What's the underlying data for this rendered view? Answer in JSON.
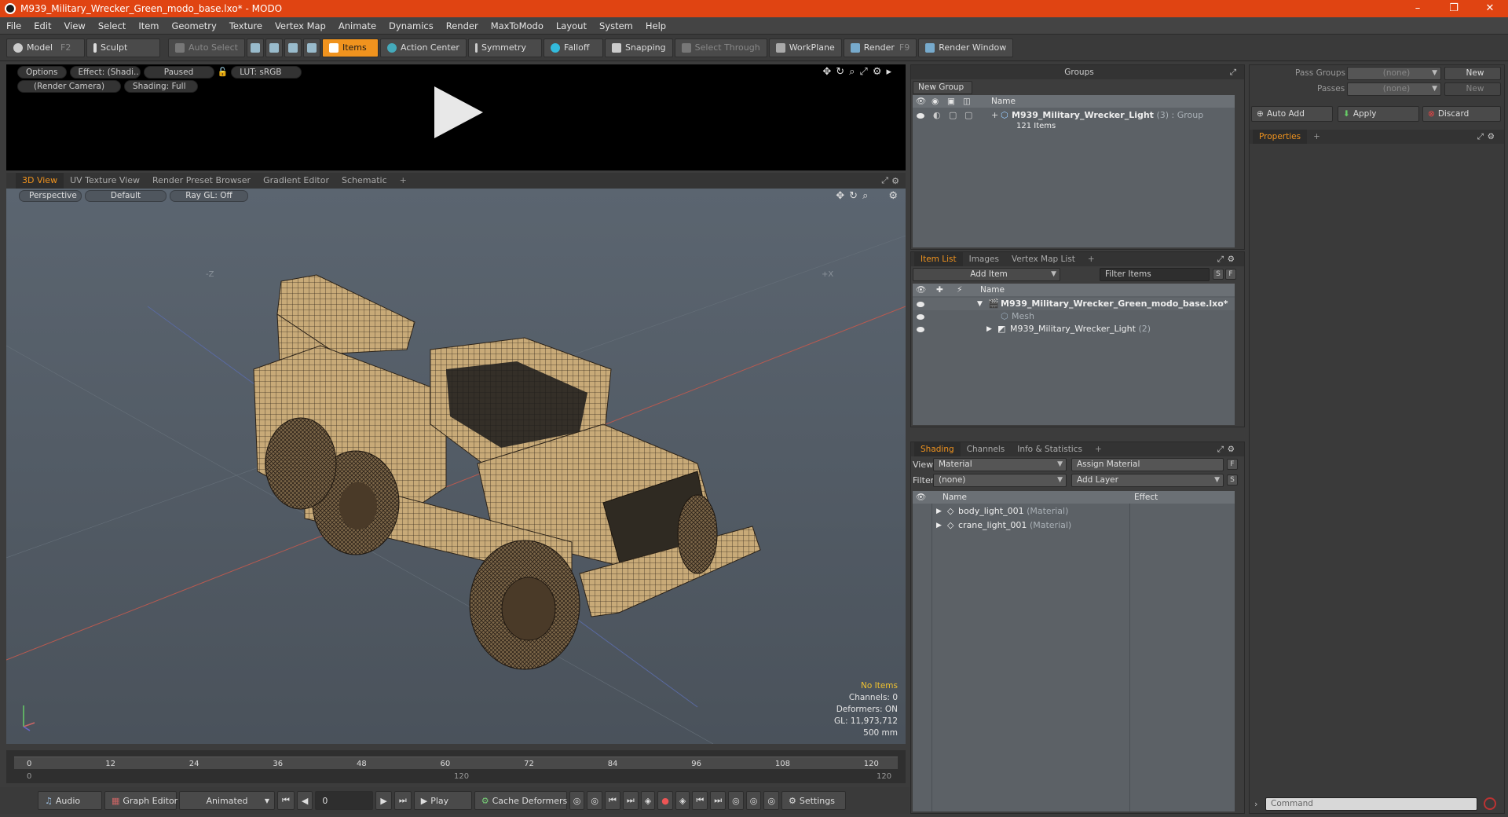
{
  "window": {
    "title": "M939_Military_Wrecker_Green_modo_base.lxo* - MODO",
    "min": "–",
    "max": "❐",
    "close": "✕"
  },
  "menu": [
    "File",
    "Edit",
    "View",
    "Select",
    "Item",
    "Geometry",
    "Texture",
    "Vertex Map",
    "Animate",
    "Dynamics",
    "Render",
    "MaxToModo",
    "Layout",
    "System",
    "Help"
  ],
  "toolbar": {
    "model": "Model",
    "model_key": "F2",
    "sculpt": "Sculpt",
    "auto_select": "Auto Select",
    "items": "Items",
    "action_center": "Action Center",
    "symmetry": "Symmetry",
    "falloff": "Falloff",
    "snapping": "Snapping",
    "select_through": "Select Through",
    "workplane": "WorkPlane",
    "render": "Render",
    "render_key": "F9",
    "render_window": "Render Window"
  },
  "preview": {
    "options": "Options",
    "effect": "Effect: (Shadi...",
    "paused": "Paused",
    "lut": "LUT: sRGB",
    "camera": "(Render Camera)",
    "shading": "Shading: Full"
  },
  "viewtabs": [
    "3D View",
    "UV Texture View",
    "Render Preset Browser",
    "Gradient Editor",
    "Schematic",
    "+"
  ],
  "viewport": {
    "perspective": "Perspective",
    "default": "Default",
    "raygl": "Ray GL: Off",
    "axis_z": "-Z",
    "axis_x": "+X",
    "stats": {
      "no_items": "No Items",
      "channels": "Channels: 0",
      "deformers": "Deformers: ON",
      "gl": "GL: 11,973,712",
      "scale": "500 mm"
    }
  },
  "timeline": {
    "top_ticks": [
      "0",
      "12",
      "24",
      "36",
      "48",
      "60",
      "72",
      "84",
      "96",
      "108",
      "120"
    ],
    "bottom_ticks": [
      "0",
      "120",
      "120"
    ]
  },
  "bottombar": {
    "audio": "Audio",
    "graph_editor": "Graph Editor",
    "animated": "Animated",
    "frame": "0",
    "play": "Play",
    "cache": "Cache Deformers",
    "settings": "Settings"
  },
  "groups": {
    "title": "Groups",
    "new_group": "New Group",
    "col_name": "Name",
    "row_name": "M939_Military_Wrecker_Light",
    "row_count": "(3)",
    "row_type": ": Group",
    "row_items": "121 Items"
  },
  "itemlist": {
    "tabs": [
      "Item List",
      "Images",
      "Vertex Map List",
      "+"
    ],
    "add_item": "Add Item",
    "filter": "Filter Items",
    "s": "S",
    "f": "F",
    "col_name": "Name",
    "rows": [
      {
        "name": "M939_Military_Wrecker_Green_modo_base.lxo*",
        "extra": ""
      },
      {
        "name": "Mesh",
        "extra": ""
      },
      {
        "name": "M939_Military_Wrecker_Light",
        "extra": "(2)"
      }
    ]
  },
  "shading": {
    "tabs": [
      "Shading",
      "Channels",
      "Info & Statistics",
      "+"
    ],
    "view_label": "View",
    "view_value": "Material",
    "assign": "Assign Material",
    "filter_label": "Filter",
    "filter_value": "(none)",
    "add_layer": "Add Layer",
    "f": "F",
    "s": "S",
    "col_name": "Name",
    "col_effect": "Effect",
    "rows": [
      {
        "name": "body_light_001",
        "type": "(Material)"
      },
      {
        "name": "crane_light_001",
        "type": "(Material)"
      }
    ]
  },
  "passes": {
    "pass_groups": "Pass Groups",
    "pass_groups_value": "(none)",
    "new": "New",
    "passes": "Passes",
    "passes_value": "(none)",
    "new2": "New",
    "auto_add": "Auto Add",
    "apply": "Apply",
    "discard": "Discard",
    "properties": "Properties",
    "plus": "+",
    "command": "Command"
  }
}
